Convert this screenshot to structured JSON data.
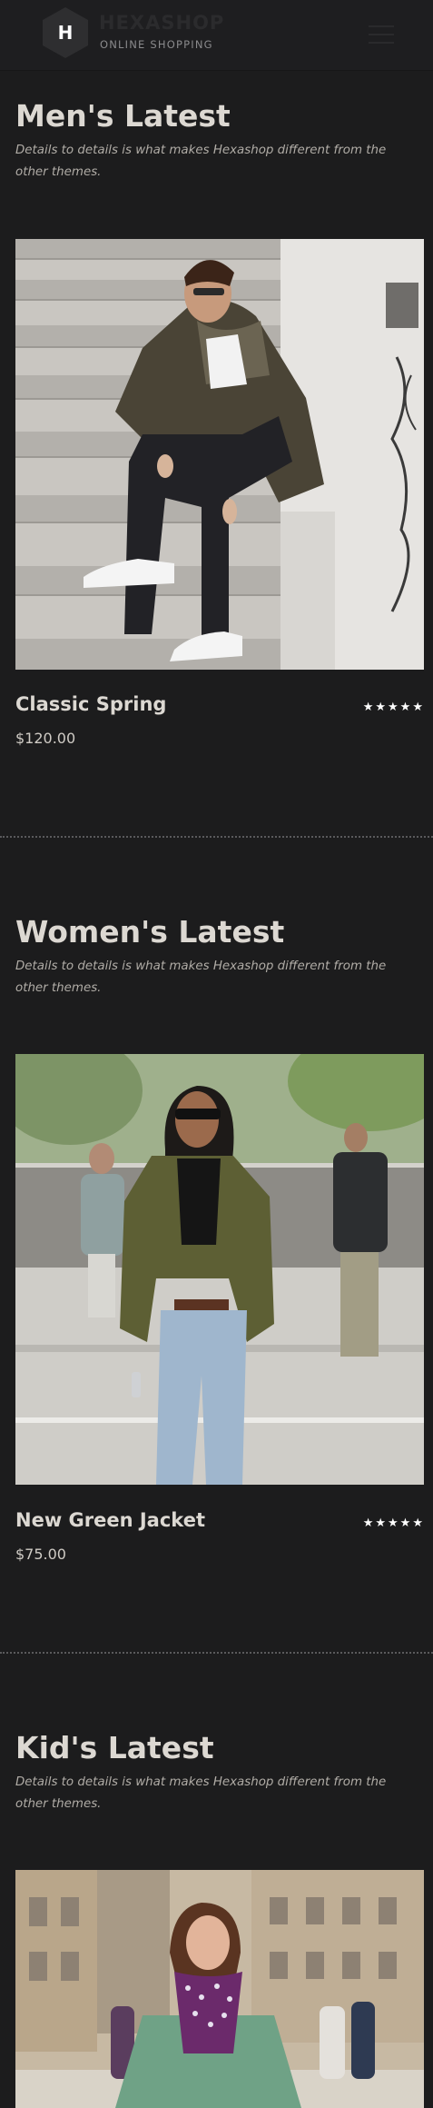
{
  "header": {
    "logo_letter": "H",
    "brand_name": "HEXASHOP",
    "brand_tagline": "ONLINE SHOPPING",
    "menu_icon": "hamburger-menu-icon"
  },
  "sections": [
    {
      "title": "Men's Latest",
      "description": "Details to details is what makes Hexashop different from the other themes.",
      "product": {
        "name": "Classic Spring",
        "price": "$120.00",
        "rating": 5,
        "image_subject": "man in camo jacket sitting on stairs"
      }
    },
    {
      "title": "Women's Latest",
      "description": "Details to details is what makes Hexashop different from the other themes.",
      "product": {
        "name": "New Green Jacket",
        "price": "$75.00",
        "rating": 5,
        "image_subject": "woman in green blazer and jeans on street"
      }
    },
    {
      "title": "Kid's Latest",
      "description": "Details to details is what makes Hexashop different from the other themes.",
      "product": {
        "image_subject": "girl in plaid jacket on city street"
      }
    }
  ],
  "stars_text": "★★★★★"
}
